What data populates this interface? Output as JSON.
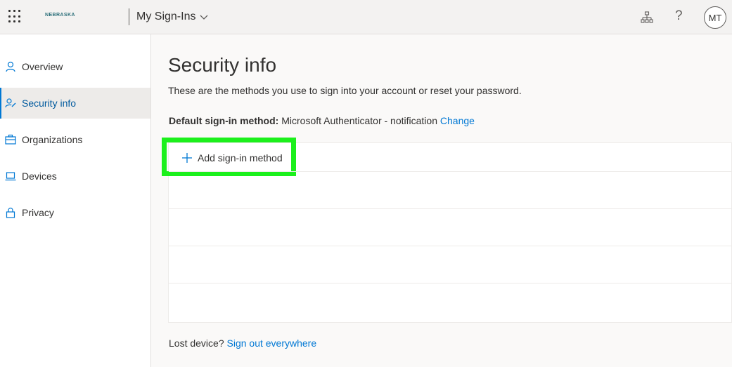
{
  "header": {
    "logo_text": "NEBRASKA",
    "app_title": "My Sign-Ins",
    "icons": [
      "waffle-icon",
      "chevron-down-icon",
      "org-chart-icon",
      "help-icon"
    ],
    "avatar_initials": "MT"
  },
  "sidebar": {
    "items": [
      {
        "label": "Overview",
        "icon": "person-icon",
        "active": false
      },
      {
        "label": "Security info",
        "icon": "security-info-icon",
        "active": true
      },
      {
        "label": "Organizations",
        "icon": "briefcase-icon",
        "active": false
      },
      {
        "label": "Devices",
        "icon": "laptop-icon",
        "active": false
      },
      {
        "label": "Privacy",
        "icon": "lock-icon",
        "active": false
      }
    ]
  },
  "main": {
    "title": "Security info",
    "description": "These are the methods you use to sign into your account or reset your password.",
    "default_method_label": "Default sign-in method:",
    "default_method_value": "Microsoft Authenticator - notification",
    "change_link": "Change",
    "add_method_label": "Add sign-in method",
    "lost_device_label": "Lost device?",
    "sign_out_link": "Sign out everywhere"
  },
  "colors": {
    "accent": "#0078d4",
    "highlight": "#1cf01c",
    "active_nav_bg": "#edebe9"
  }
}
